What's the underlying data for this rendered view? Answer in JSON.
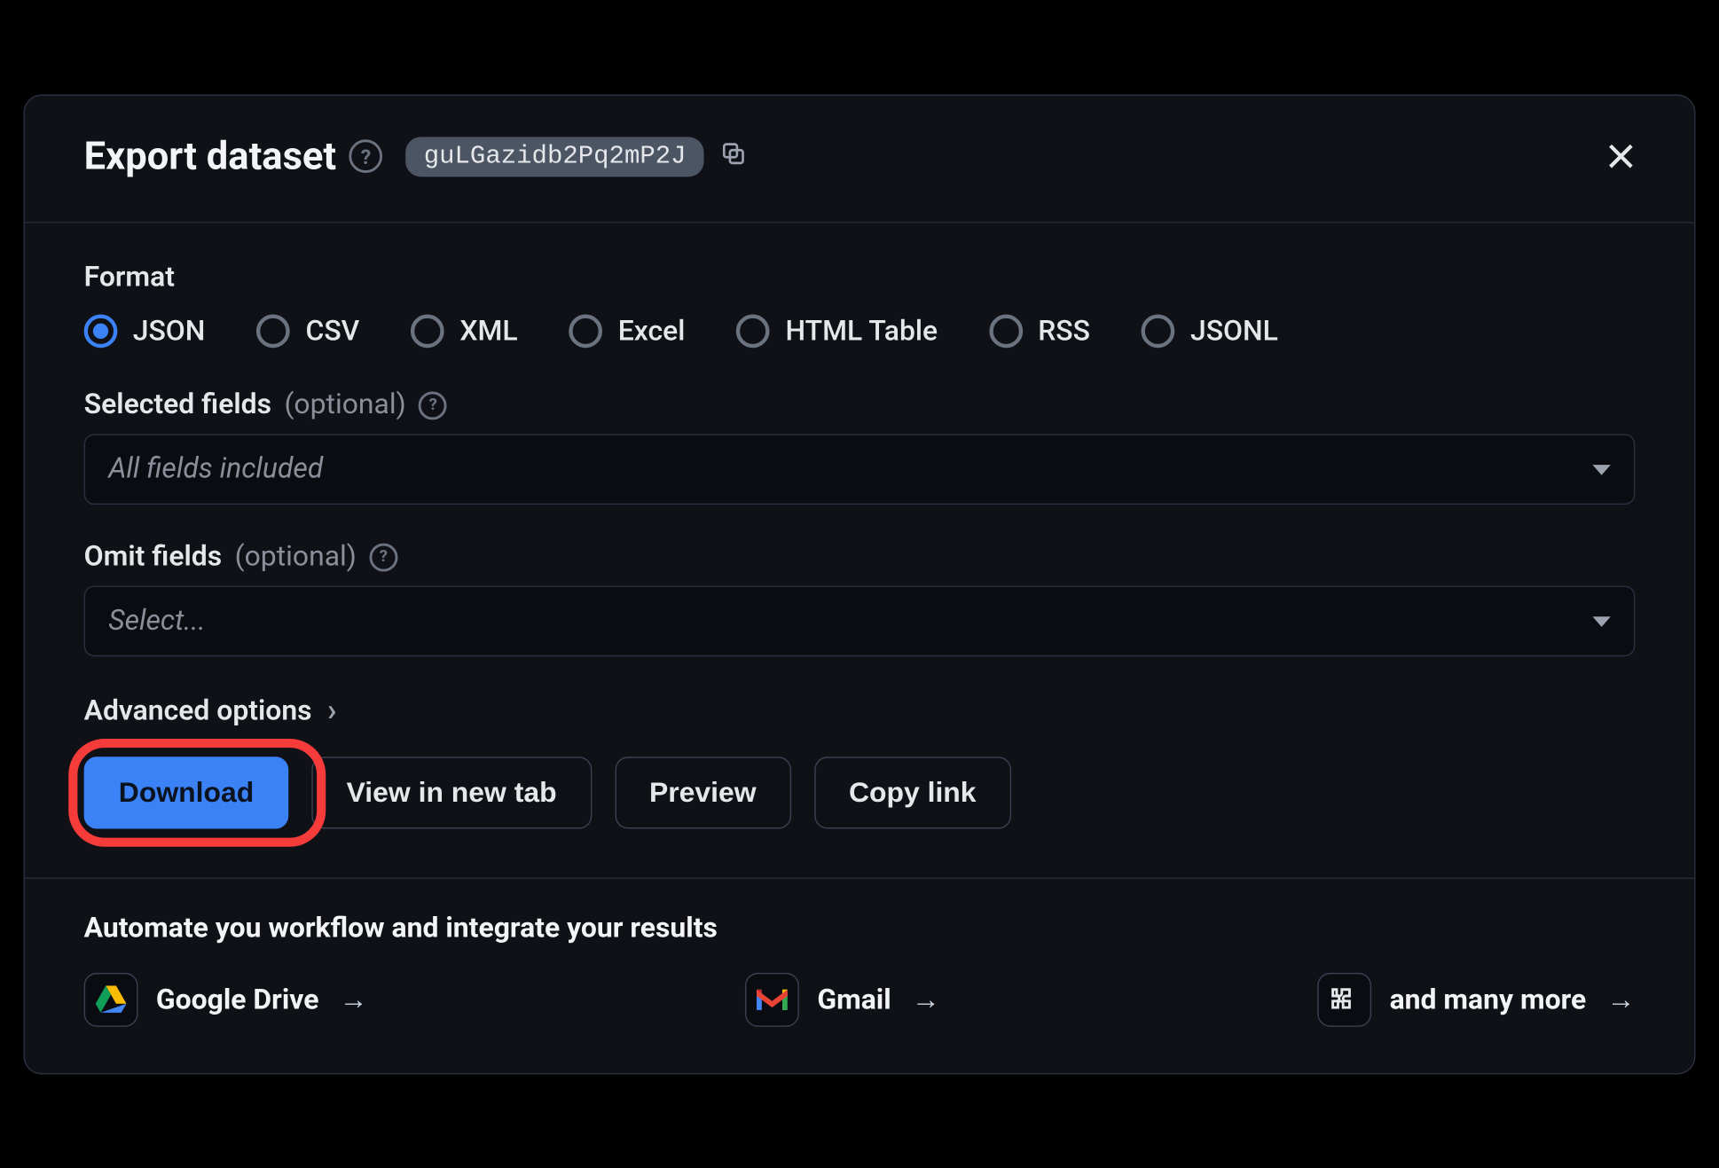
{
  "header": {
    "title": "Export dataset",
    "dataset_id": "guLGazidb2Pq2mP2J"
  },
  "format": {
    "label": "Format",
    "selected": "JSON",
    "options": [
      "JSON",
      "CSV",
      "XML",
      "Excel",
      "HTML Table",
      "RSS",
      "JSONL"
    ]
  },
  "selected_fields": {
    "label": "Selected fields",
    "optional": "(optional)",
    "placeholder": "All fields included"
  },
  "omit_fields": {
    "label": "Omit fields",
    "optional": "(optional)",
    "placeholder": "Select..."
  },
  "advanced": {
    "label": "Advanced options"
  },
  "buttons": {
    "download": "Download",
    "view_new_tab": "View in new tab",
    "preview": "Preview",
    "copy_link": "Copy link"
  },
  "footer": {
    "title": "Automate you workflow and integrate your results",
    "items": [
      {
        "label": "Google Drive"
      },
      {
        "label": "Gmail"
      },
      {
        "label": "and many more"
      }
    ]
  },
  "annotation": {
    "highlighted_button": "download"
  }
}
